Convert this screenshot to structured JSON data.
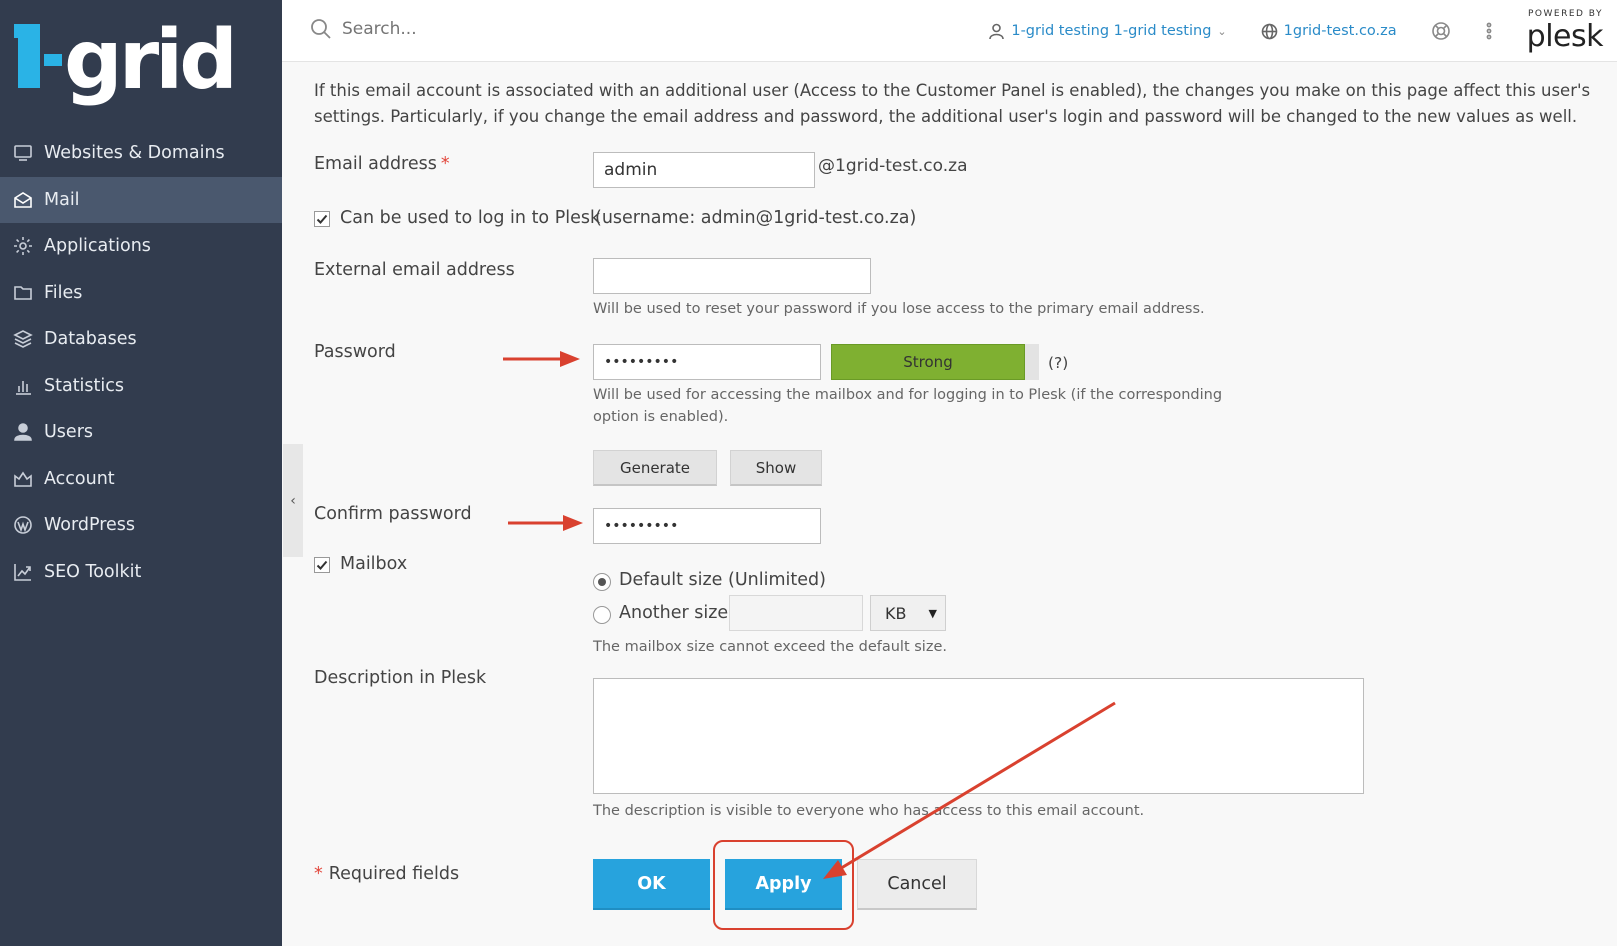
{
  "brand": {
    "logo_text": "1-grid",
    "powered_by": "POWERED BY",
    "plesk": "plesk"
  },
  "sidebar": {
    "items": [
      {
        "label": "Websites & Domains",
        "icon": "monitor-icon",
        "active": false
      },
      {
        "label": "Mail",
        "icon": "mail-icon",
        "active": true
      },
      {
        "label": "Applications",
        "icon": "gear-icon",
        "active": false
      },
      {
        "label": "Files",
        "icon": "folder-icon",
        "active": false
      },
      {
        "label": "Databases",
        "icon": "database-icon",
        "active": false
      },
      {
        "label": "Statistics",
        "icon": "bar-chart-icon",
        "active": false
      },
      {
        "label": "Users",
        "icon": "user-icon",
        "active": false
      },
      {
        "label": "Account",
        "icon": "account-icon",
        "active": false
      },
      {
        "label": "WordPress",
        "icon": "wordpress-icon",
        "active": false
      },
      {
        "label": "SEO Toolkit",
        "icon": "seo-chart-icon",
        "active": false
      }
    ],
    "collapse_glyph": "‹"
  },
  "topbar": {
    "search_placeholder": "Search...",
    "user": "1-grid testing 1-grid testing",
    "domain": "1grid-test.co.za"
  },
  "form": {
    "intro": "If this email account is associated with an additional user (Access to the Customer Panel is enabled), the changes you make on this page affect this user's settings. Particularly, if you change the email address and password, the additional user's login and password will be changed to the new values as well.",
    "email_label": "Email address",
    "email_value": "admin",
    "email_domain": "@1grid-test.co.za",
    "login_checkbox_label": "Can be used to log in to Plesk",
    "login_checkbox_checked": true,
    "login_username_note": "(username: admin@1grid-test.co.za)",
    "external_label": "External email address",
    "external_value": "",
    "external_hint": "Will be used to reset your password if you lose access to the primary email address.",
    "password_label": "Password",
    "password_value": "•••••••••",
    "strength_text": "Strong",
    "strength_color": "#7fb031",
    "password_help": "(?)",
    "password_hint": "Will be used for accessing the mailbox and for logging in to Plesk (if the corresponding option is enabled).",
    "generate_label": "Generate",
    "show_label": "Show",
    "confirm_label": "Confirm password",
    "confirm_value": "•••••••••",
    "mailbox_label": "Mailbox",
    "mailbox_checked": true,
    "radio_default_label": "Default size (Unlimited)",
    "radio_other_label": "Another size",
    "size_unit": "KB",
    "mailbox_hint": "The mailbox size cannot exceed the default size.",
    "description_label": "Description in Plesk",
    "description_value": "",
    "description_hint": "The description is visible to everyone who has access to this email account.",
    "required_note": "Required fields",
    "required_marker": "*"
  },
  "actions": {
    "ok": "OK",
    "apply": "Apply",
    "cancel": "Cancel"
  },
  "colors": {
    "sidebar_bg": "#323c4e",
    "accent": "#27a3dd",
    "annotation": "#d9412f",
    "link": "#2a8bc8"
  }
}
